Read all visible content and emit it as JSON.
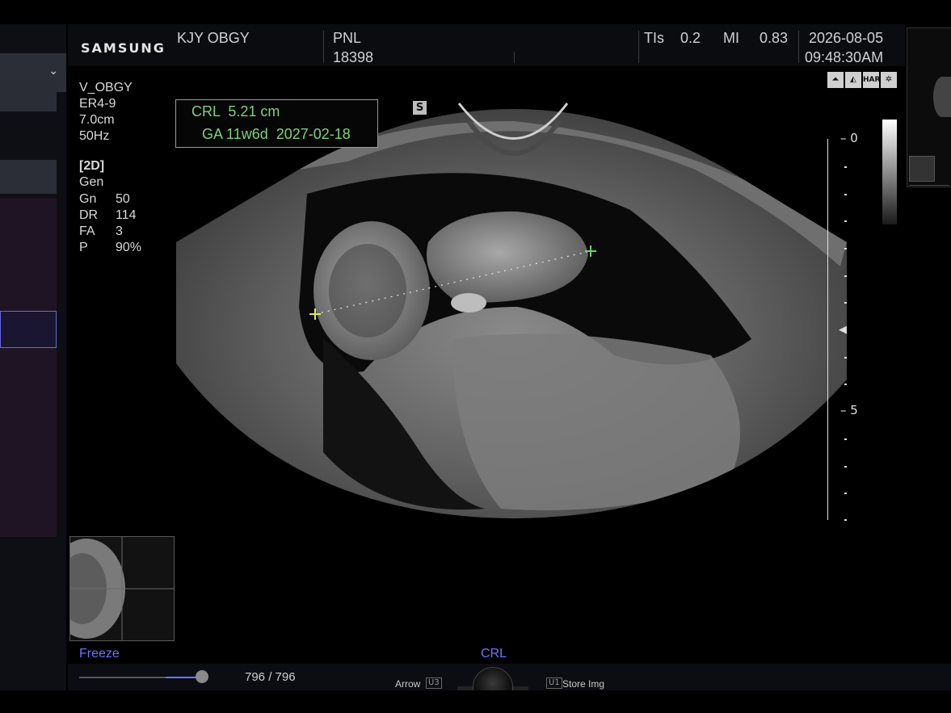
{
  "header": {
    "brand": "SAMSUNG",
    "institution": "KJY OBGY",
    "patient_label": "PNL",
    "patient_id": "18398",
    "tis_label": "TIs",
    "tis_value": "0.2",
    "mi_label": "MI",
    "mi_value": "0.83",
    "date": "2026-08-05",
    "time": "09:48:30AM"
  },
  "params": {
    "preset": "V_OBGY",
    "probe": "ER4-9",
    "depth": "7.0cm",
    "frame_rate": "50Hz",
    "mode": "[2D]",
    "mode_setting": "Gen",
    "rows": [
      {
        "label": "Gn",
        "value": "50"
      },
      {
        "label": "DR",
        "value": "114"
      },
      {
        "label": "FA",
        "value": "3"
      },
      {
        "label": "P",
        "value": "90%"
      }
    ]
  },
  "measurement": {
    "line1": "CRL  5.21 cm",
    "line2": "GA 11w6d  2027-02-18"
  },
  "badges": {
    "s": "S"
  },
  "toolbar_icons": [
    {
      "name": "flip-up-down-icon",
      "glyph": "⏶"
    },
    {
      "name": "probe-icon",
      "glyph": "◭"
    },
    {
      "name": "har-icon",
      "glyph": "HAR"
    },
    {
      "name": "film-reel-icon",
      "glyph": "✲"
    }
  ],
  "depth_scale": {
    "labels": [
      {
        "value": "0"
      },
      {
        "value": "5"
      }
    ]
  },
  "bottom": {
    "freeze_label": "Freeze",
    "frame_counter": "796 / 796",
    "crl_label": "CRL",
    "arrow_label": "Arrow",
    "arrow_key": "U3",
    "store_key": "U1",
    "store_label": "Store Img",
    "cine_progress": 1.0
  },
  "colors": {
    "accent": "#6b73ff",
    "measurement": "#7fd27a",
    "caliper_start": "#e6e85a",
    "caliper_end": "#6bd16b"
  }
}
